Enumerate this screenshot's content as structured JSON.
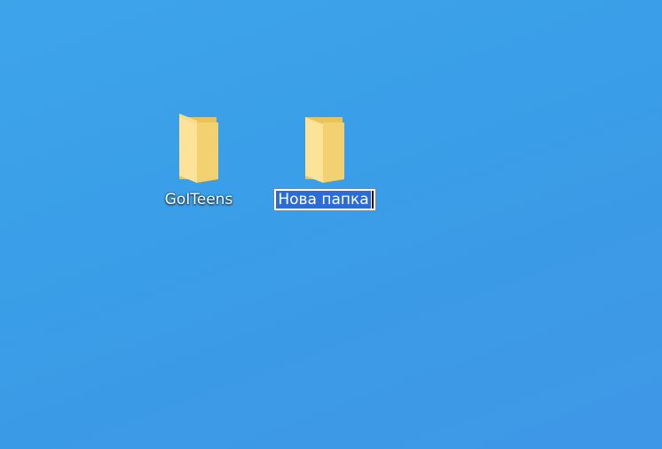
{
  "desktop": {
    "icons": [
      {
        "label": "GoITeens",
        "icon": "folder-icon",
        "state": "normal"
      },
      {
        "label": "Нова папка",
        "icon": "folder-icon",
        "state": "renaming"
      }
    ]
  },
  "colors": {
    "desktop_background": "#3b9ee8",
    "folder_front": "#f6d57b",
    "folder_back": "#e9c25a",
    "selection": "#2d6bd6"
  }
}
